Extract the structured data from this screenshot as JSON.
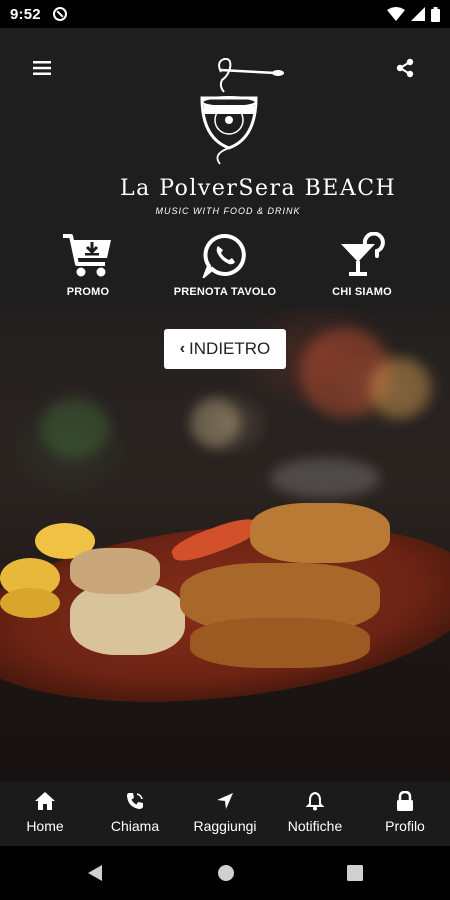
{
  "status_bar": {
    "time": "9:52"
  },
  "logo": {
    "title": "La PolverSera BEACH",
    "subtitle": "MUSIC WITH FOOD & DRINK"
  },
  "actions": [
    {
      "label": "PROMO",
      "icon": "cart-download-icon"
    },
    {
      "label": "PRENOTA TAVOLO",
      "icon": "whatsapp-icon"
    },
    {
      "label": "CHI SIAMO",
      "icon": "cocktail-question-icon"
    }
  ],
  "back_button": {
    "label": "INDIETRO"
  },
  "bottom_nav": [
    {
      "label": "Home",
      "icon": "home-icon"
    },
    {
      "label": "Chiama",
      "icon": "phone-icon"
    },
    {
      "label": "Raggiungi",
      "icon": "location-arrow-icon"
    },
    {
      "label": "Notifiche",
      "icon": "bell-icon"
    },
    {
      "label": "Profilo",
      "icon": "lock-icon"
    }
  ],
  "colors": {
    "header_bg": "#1e1e1e",
    "nav_bg": "#1b1b1b",
    "accent": "#ffffff",
    "button_text": "#222222"
  }
}
